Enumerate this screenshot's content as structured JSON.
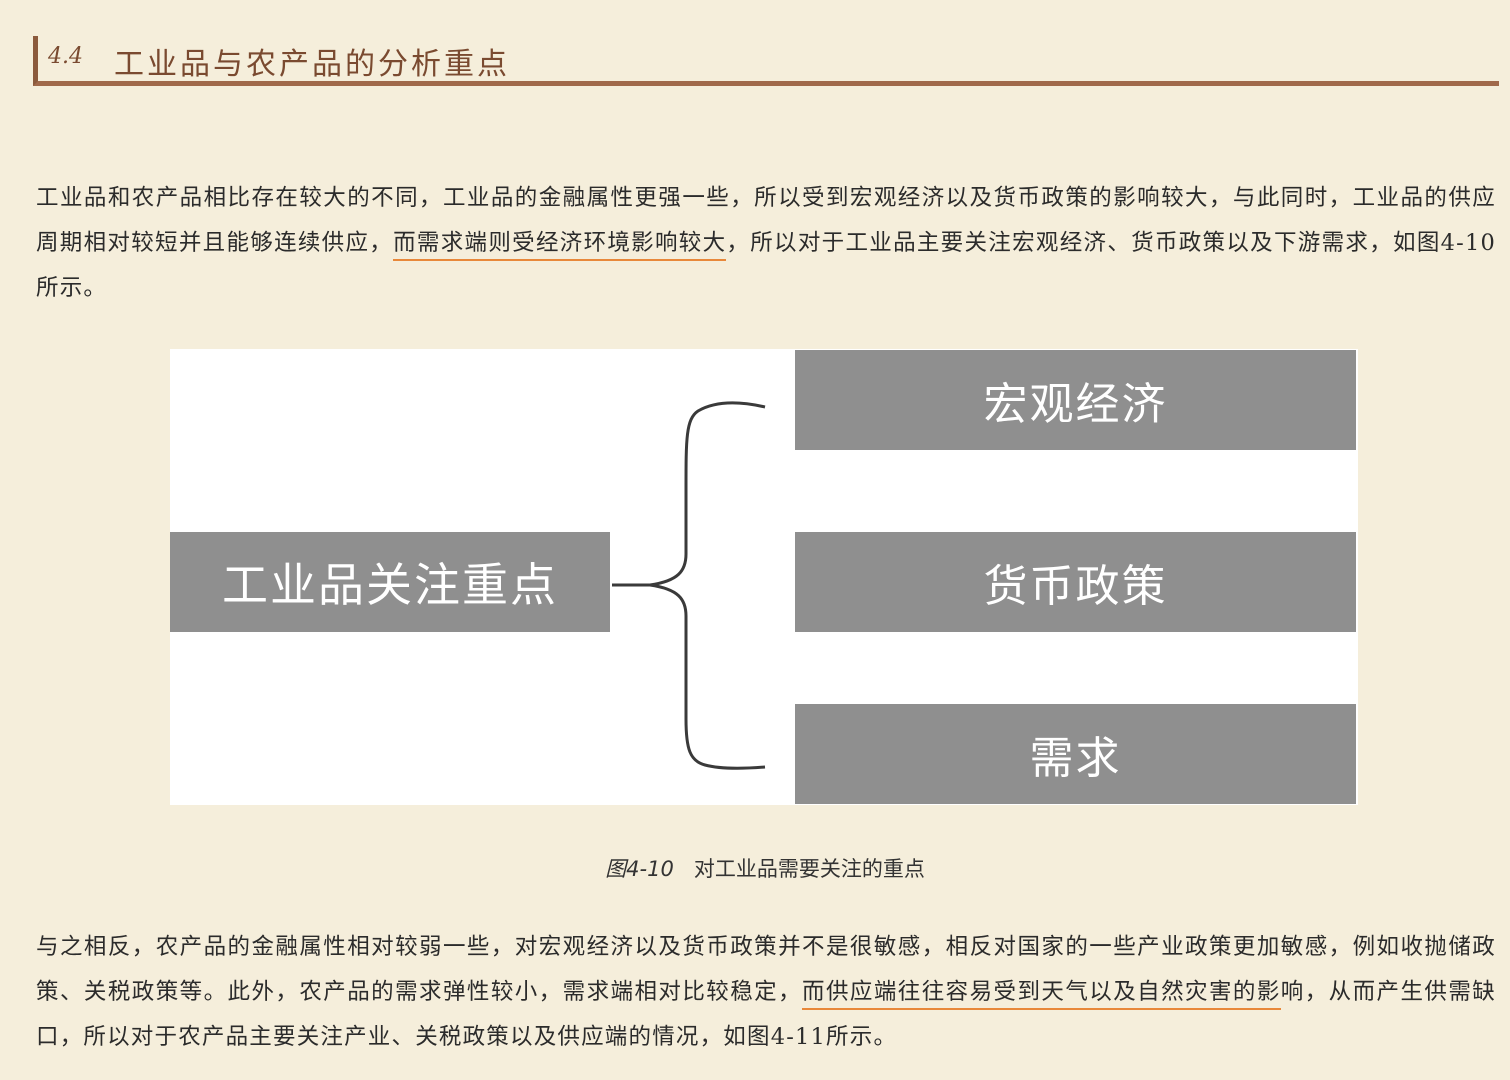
{
  "section": {
    "number": "4.4",
    "title": "工业品与农产品的分析重点"
  },
  "paragraph1": {
    "before": "工业品和农产品相比存在较大的不同，工业品的金融属性更强一些，所以受到宏观经济以及货币政策的影响较大，与此同时，工业品的供应周期相对较短并且能够连续供应，",
    "highlight": "而需求端则受经济环境影响较大",
    "after": "，所以对于工业品主要关注宏观经济、货币政策以及下游需求，如图4-10所示。"
  },
  "figure": {
    "main_label": "工业品关注重点",
    "items": [
      "宏观经济",
      "货币政策",
      "需求"
    ]
  },
  "caption": {
    "number": "图4-10",
    "text": "对工业品需要关注的重点"
  },
  "paragraph2": {
    "before": "与之相反，农产品的金融属性相对较弱一些，对宏观经济以及货币政策并不是很敏感，相反对国家的一些产业政策更加敏感，例如收抛储政策、关税政策等。此外，农产品的需求弹性较小，需求端相对比较稳定，",
    "highlight": "而供应端往往容易受到天气以及自然灾害的影",
    "after": "响，从而产生供需缺口，所以对于农产品主要关注产业、关税政策以及供应端的情况，如图4-11所示。"
  },
  "colors": {
    "background": "#f5eedb",
    "header_accent": "#8b5a3c",
    "highlight_underline": "#e8883a",
    "figure_box": "#8f8f8f"
  }
}
